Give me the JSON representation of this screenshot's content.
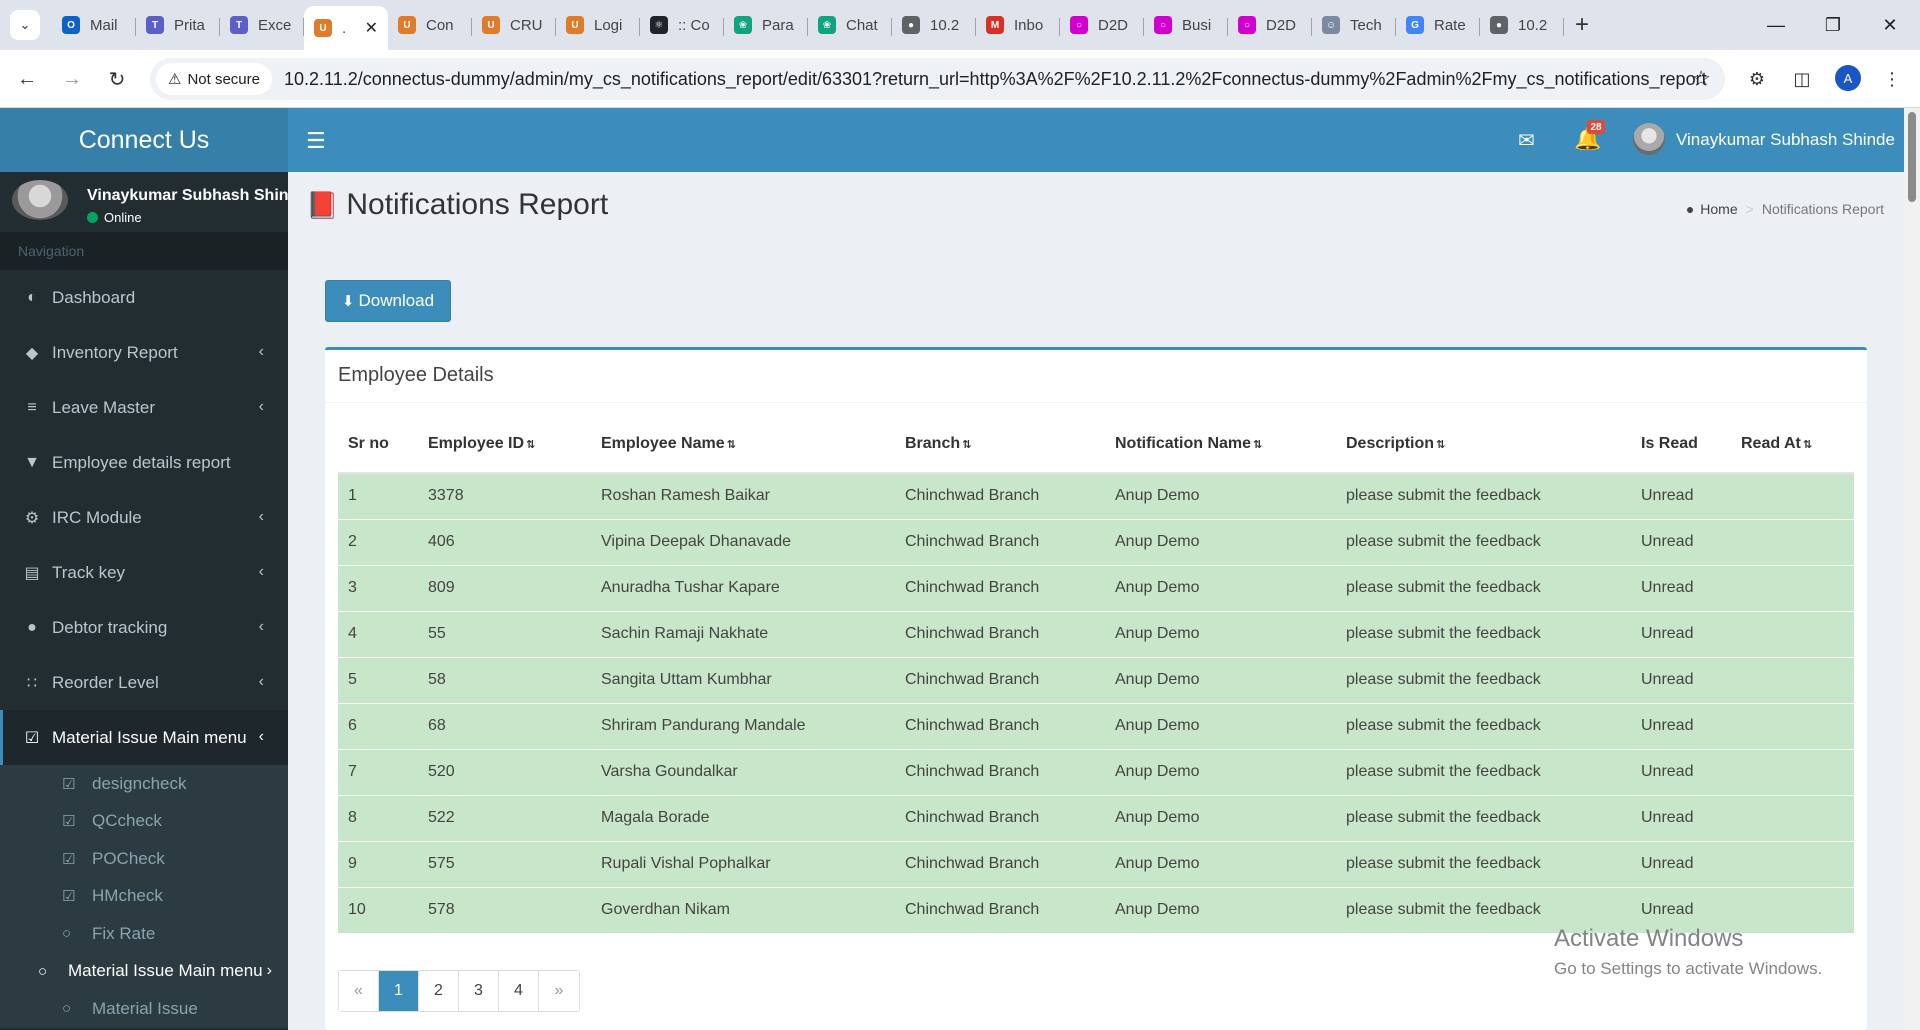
{
  "browser": {
    "tabs": [
      {
        "title": "Mail",
        "icon": "outlook-icon",
        "color": "#0f62c4"
      },
      {
        "title": "Prita",
        "icon": "teams-icon",
        "color": "#5b5fc7"
      },
      {
        "title": "Exce",
        "icon": "teams-icon",
        "color": "#5b5fc7"
      },
      {
        "title": ".",
        "icon": "app-icon",
        "color": "#e07b2a",
        "active": true
      },
      {
        "title": "Con",
        "icon": "app-icon",
        "color": "#e07b2a"
      },
      {
        "title": "CRU",
        "icon": "app-icon",
        "color": "#e07b2a"
      },
      {
        "title": "Logi",
        "icon": "app-icon",
        "color": "#e07b2a"
      },
      {
        "title": ":: Co",
        "icon": "react-icon",
        "color": "#20232a"
      },
      {
        "title": "Para",
        "icon": "chatgpt-icon",
        "color": "#10a37f"
      },
      {
        "title": "Chat",
        "icon": "chatgpt-icon",
        "color": "#10a37f"
      },
      {
        "title": "10.2",
        "icon": "globe-icon",
        "color": "#5f6368"
      },
      {
        "title": "Inbo",
        "icon": "gmail-icon",
        "color": "#d93025"
      },
      {
        "title": "D2D",
        "icon": "ring-icon",
        "color": "#d100d1"
      },
      {
        "title": "Busi",
        "icon": "ring-icon",
        "color": "#d100d1"
      },
      {
        "title": "D2D",
        "icon": "ring-icon",
        "color": "#d100d1"
      },
      {
        "title": "Tech",
        "icon": "person-icon",
        "color": "#7a8aa0"
      },
      {
        "title": "Rate",
        "icon": "google-icon",
        "color": "#4285f4"
      },
      {
        "title": "10.2",
        "icon": "globe-icon",
        "color": "#5f6368"
      }
    ],
    "security_label": "Not secure",
    "url": "10.2.11.2/connectus-dummy/admin/my_cs_notifications_report/edit/63301?return_url=http%3A%2F%2F10.2.11.2%2Fconnectus-dummy%2Fadmin%2Fmy_cs_notifications_report",
    "profile_initial": "A"
  },
  "app": {
    "brand": "Connect Us",
    "user_name": "Vinaykumar Subhash Shinde",
    "status": "Online",
    "nav_header": "Navigation",
    "notification_count": "28"
  },
  "sidebar": {
    "items": [
      {
        "label": "Dashboard",
        "icon": "dashboard-icon",
        "chevron": false
      },
      {
        "label": "Inventory Report",
        "icon": "tag-icon",
        "chevron": true
      },
      {
        "label": "Leave Master",
        "icon": "database-icon",
        "chevron": true
      },
      {
        "label": "Employee details report",
        "icon": "filter-icon",
        "chevron": false
      },
      {
        "label": "IRC Module",
        "icon": "gear-icon",
        "chevron": true
      },
      {
        "label": "Track key",
        "icon": "id-card-icon",
        "chevron": true
      },
      {
        "label": "Debtor tracking",
        "icon": "map-marker-icon",
        "chevron": true
      },
      {
        "label": "Reorder Level",
        "icon": "sitemap-icon",
        "chevron": true
      },
      {
        "label": "Material Issue Main menu",
        "icon": "check-square-icon",
        "chevron": true,
        "active": true
      }
    ],
    "subitems": [
      {
        "label": "designcheck",
        "icon": "check-square-icon"
      },
      {
        "label": "QCcheck",
        "icon": "check-square-icon"
      },
      {
        "label": "POCheck",
        "icon": "check-square-icon"
      },
      {
        "label": "HMcheck",
        "icon": "check-square-icon"
      },
      {
        "label": "Fix Rate",
        "icon": "circle-icon"
      },
      {
        "label": "Material Issue Main menu",
        "icon": "circle-icon",
        "open": true
      },
      {
        "label": "Material Issue",
        "icon": "circle-icon"
      }
    ]
  },
  "page": {
    "title": "Notifications Report",
    "breadcrumb_home": "Home",
    "breadcrumb_current": "Notifications Report",
    "download_label": "Download",
    "box_title": "Employee Details"
  },
  "table": {
    "columns": [
      {
        "label": "Sr no",
        "sortable": false,
        "width": 80
      },
      {
        "label": "Employee ID",
        "sortable": true,
        "width": 173
      },
      {
        "label": "Employee Name",
        "sortable": true,
        "width": 304
      },
      {
        "label": "Branch",
        "sortable": true,
        "width": 210
      },
      {
        "label": "Notification Name",
        "sortable": true,
        "width": 231
      },
      {
        "label": "Description",
        "sortable": true,
        "width": 295
      },
      {
        "label": "Is Read",
        "sortable": false,
        "width": 100
      },
      {
        "label": "Read At",
        "sortable": true,
        "width": 123
      }
    ],
    "rows": [
      [
        "1",
        "3378",
        "Roshan Ramesh Baikar",
        "Chinchwad Branch",
        "Anup Demo",
        "please submit the feedback",
        "Unread",
        ""
      ],
      [
        "2",
        "406",
        "Vipina Deepak Dhanavade",
        "Chinchwad Branch",
        "Anup Demo",
        "please submit the feedback",
        "Unread",
        ""
      ],
      [
        "3",
        "809",
        "Anuradha Tushar Kapare",
        "Chinchwad Branch",
        "Anup Demo",
        "please submit the feedback",
        "Unread",
        ""
      ],
      [
        "4",
        "55",
        "Sachin Ramaji Nakhate",
        "Chinchwad Branch",
        "Anup Demo",
        "please submit the feedback",
        "Unread",
        ""
      ],
      [
        "5",
        "58",
        "Sangita Uttam Kumbhar",
        "Chinchwad Branch",
        "Anup Demo",
        "please submit the feedback",
        "Unread",
        ""
      ],
      [
        "6",
        "68",
        "Shriram Pandurang Mandale",
        "Chinchwad Branch",
        "Anup Demo",
        "please submit the feedback",
        "Unread",
        ""
      ],
      [
        "7",
        "520",
        "Varsha Goundalkar",
        "Chinchwad Branch",
        "Anup Demo",
        "please submit the feedback",
        "Unread",
        ""
      ],
      [
        "8",
        "522",
        "Magala Borade",
        "Chinchwad Branch",
        "Anup Demo",
        "please submit the feedback",
        "Unread",
        ""
      ],
      [
        "9",
        "575",
        "Rupali Vishal Pophalkar",
        "Chinchwad Branch",
        "Anup Demo",
        "please submit the feedback",
        "Unread",
        ""
      ],
      [
        "10",
        "578",
        "Goverdhan Nikam",
        "Chinchwad Branch",
        "Anup Demo",
        "please submit the feedback",
        "Unread",
        ""
      ]
    ]
  },
  "pagination": {
    "prev": "«",
    "pages": [
      "1",
      "2",
      "3",
      "4"
    ],
    "current": "1",
    "next": "»"
  },
  "watermark": {
    "line1": "Activate Windows",
    "line2": "Go to Settings to activate Windows."
  }
}
